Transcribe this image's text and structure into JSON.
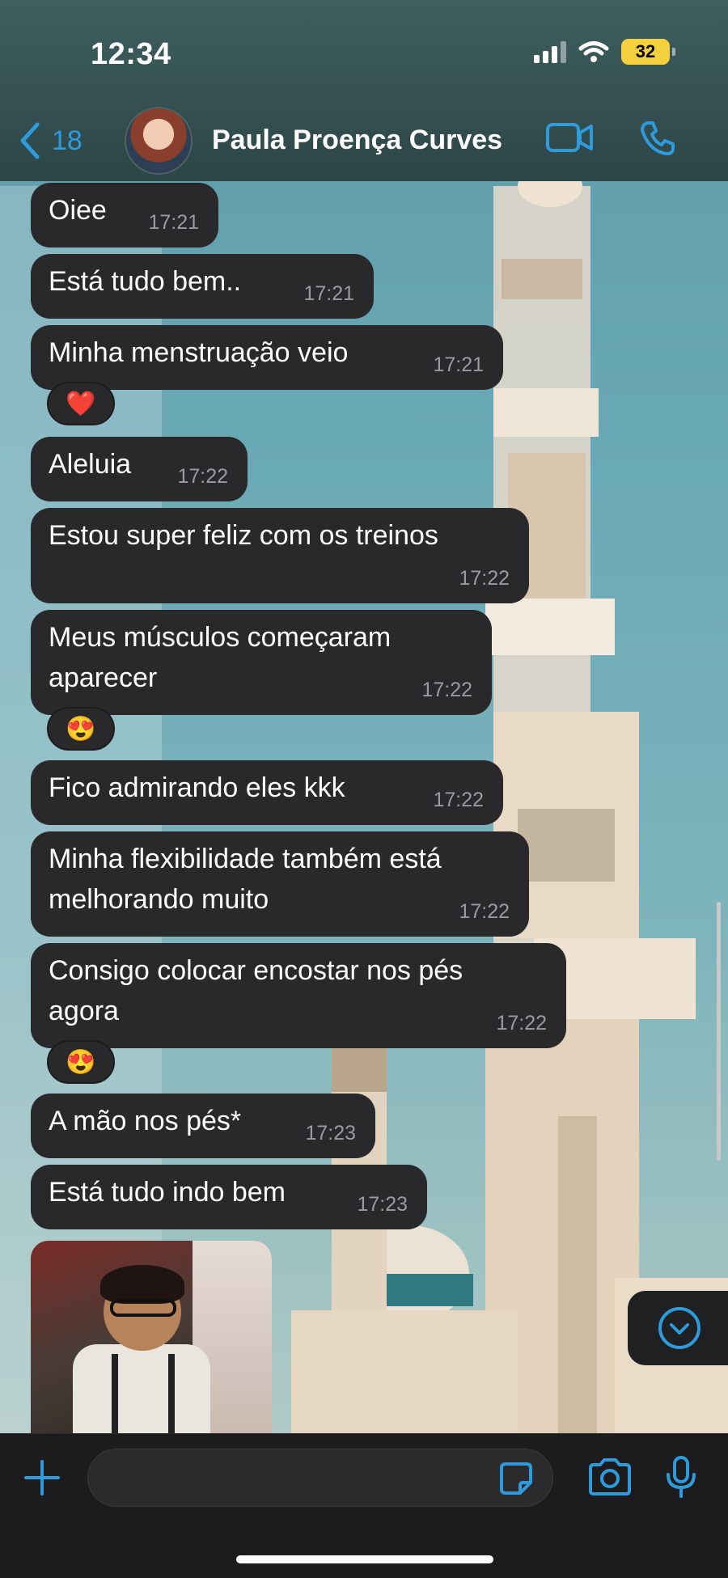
{
  "status_bar": {
    "time": "12:34",
    "battery": "32"
  },
  "header": {
    "back_count": "18",
    "contact_name": "Paula Proença Curves",
    "accent_color": "#2f9bdd"
  },
  "messages": [
    {
      "text": "Oiee",
      "time": "17:21"
    },
    {
      "text": "Está tudo bem..",
      "time": "17:21"
    },
    {
      "text": "Minha menstruação veio",
      "time": "17:21",
      "reaction": "❤️"
    },
    {
      "text": "Aleluia",
      "time": "17:22"
    },
    {
      "text": "Estou super feliz com os treinos",
      "time": "17:22"
    },
    {
      "text_lines": [
        "Meus músculos começaram",
        "aparecer"
      ],
      "time": "17:22",
      "reaction": "😍"
    },
    {
      "text": "Fico admirando eles kkk",
      "time": "17:22"
    },
    {
      "text_lines": [
        "Minha flexibilidade também está",
        "melhorando muito"
      ],
      "time": "17:22"
    },
    {
      "text_lines": [
        "Consigo colocar encostar nos pés",
        "agora"
      ],
      "time": "17:22",
      "reaction": "😍"
    },
    {
      "text": "A mão nos pés*",
      "time": "17:23"
    },
    {
      "text": "Está tudo indo bem",
      "time": "17:23"
    }
  ],
  "icons": {
    "back": "chevron-left-icon",
    "video_call": "video-camera-icon",
    "voice_call": "phone-icon",
    "scroll_down": "chevron-down-circle-icon",
    "attach": "plus-icon",
    "sticker": "sticker-icon",
    "camera": "camera-icon",
    "mic": "microphone-icon"
  }
}
